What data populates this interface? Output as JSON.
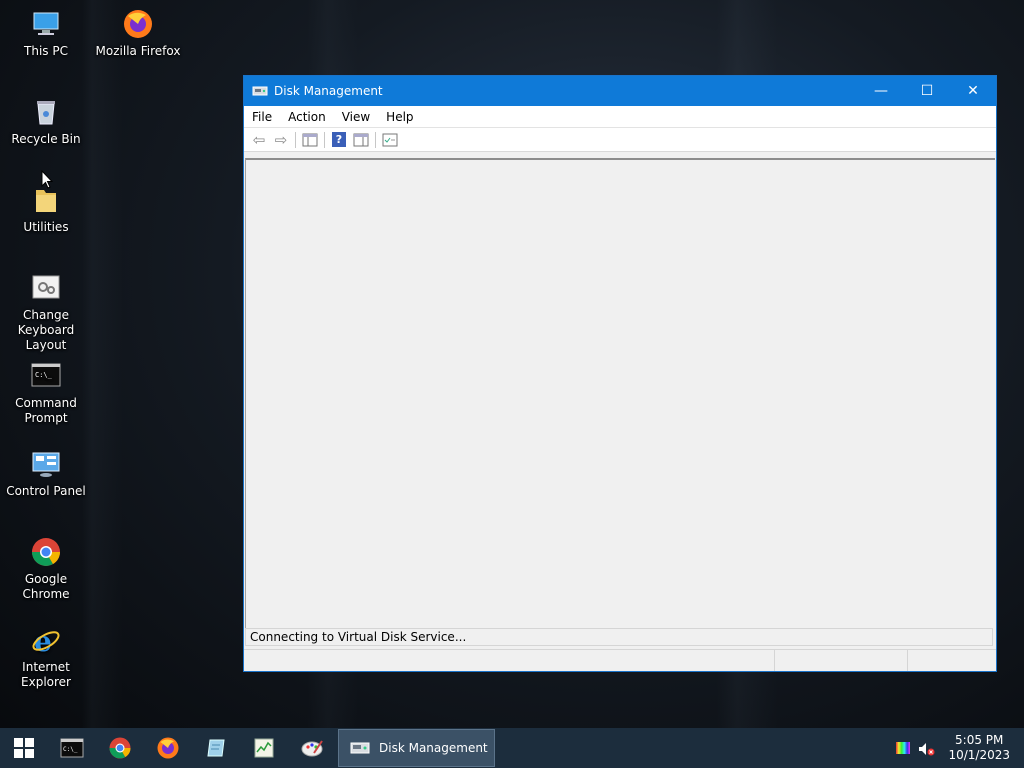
{
  "desktop": {
    "icons": [
      {
        "label": "This PC",
        "icon": "this-pc-icon"
      },
      {
        "label": "Mozilla Firefox",
        "icon": "firefox-icon"
      },
      {
        "label": "Recycle Bin",
        "icon": "recycle-bin-icon"
      },
      {
        "label": "Utilities",
        "icon": "folder-icon"
      },
      {
        "label": "Change Keyboard Layout",
        "icon": "keyboard-settings-icon"
      },
      {
        "label": "Command Prompt",
        "icon": "command-prompt-icon"
      },
      {
        "label": "Control Panel",
        "icon": "control-panel-icon"
      },
      {
        "label": "Google Chrome",
        "icon": "chrome-icon"
      },
      {
        "label": "Internet Explorer",
        "icon": "internet-explorer-icon"
      }
    ]
  },
  "window": {
    "title": "Disk Management",
    "controls": {
      "minimize": "—",
      "maximize": "☐",
      "close": "✕"
    },
    "menu": [
      "File",
      "Action",
      "View",
      "Help"
    ],
    "toolbar": {
      "back": "⇦",
      "forward": "⇨",
      "help": "?"
    },
    "status_message": "Connecting to Virtual Disk Service..."
  },
  "taskbar": {
    "start_icon": "windows-start-icon",
    "pinned": [
      "command-prompt-icon",
      "chrome-icon",
      "firefox-icon",
      "notepad-icon",
      "task-manager-icon",
      "paint-icon"
    ],
    "active_app": "Disk Management",
    "clock": {
      "time": "5:05 PM",
      "date": "10/1/2023"
    }
  },
  "colors": {
    "titlebar": "#0f7ad8",
    "taskbar": "#1c2d3d",
    "taskbar_active": "#3b5166"
  }
}
